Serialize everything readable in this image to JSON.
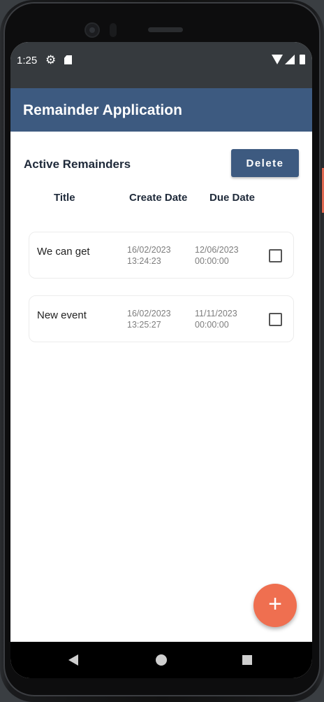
{
  "status_bar": {
    "time": "1:25",
    "icons": [
      "settings-icon",
      "sd-card-icon",
      "wifi-icon",
      "signal-icon",
      "battery-icon"
    ]
  },
  "app_bar": {
    "title": "Remainder Application",
    "color": "#3d5a80"
  },
  "section": {
    "title": "Active Remainders",
    "delete_label": "Delete"
  },
  "columns": {
    "title": "Title",
    "create_date": "Create Date",
    "due_date": "Due Date"
  },
  "reminders": [
    {
      "title": "We can get",
      "create_date": "16/02/2023",
      "create_time": "13:24:23",
      "due_date": "12/06/2023",
      "due_time": "00:00:00",
      "checked": false
    },
    {
      "title": "New event",
      "create_date": "16/02/2023",
      "create_time": "13:25:27",
      "due_date": "11/11/2023",
      "due_time": "00:00:00",
      "checked": false
    }
  ],
  "fab": {
    "label": "+",
    "color": "#ef6f50"
  },
  "nav_bar": {
    "icons": [
      "back-icon",
      "home-icon",
      "recents-icon"
    ]
  }
}
